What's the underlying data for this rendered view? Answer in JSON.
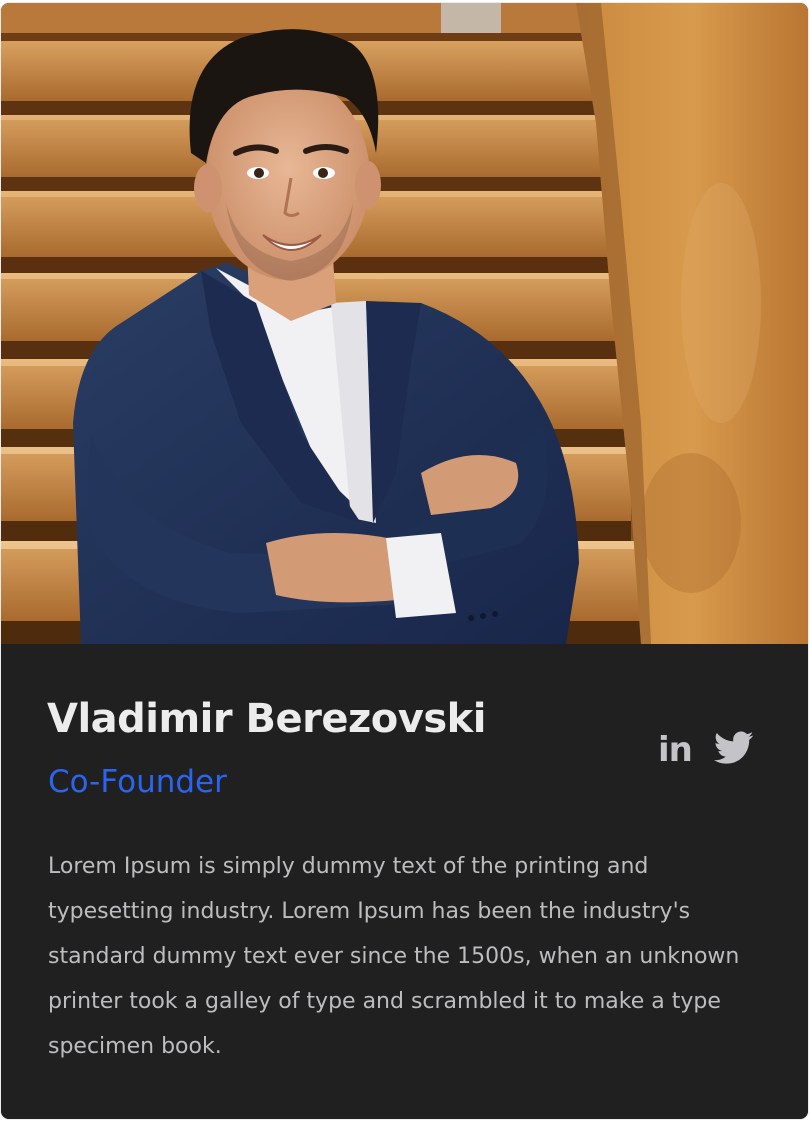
{
  "profile": {
    "name": "Vladimir Berezovski",
    "role": "Co-Founder",
    "bio": "Lorem Ipsum is simply dummy text of the printing and typesetting industry. Lorem Ipsum has been the industry's standard dummy text ever since the 1500s, when an unknown printer took a galley of type and scrambled it to make a type specimen book."
  },
  "social": {
    "linkedin_label": "in",
    "linkedin_icon": "linkedin-icon",
    "twitter_icon": "twitter-icon"
  },
  "colors": {
    "card_background": "#202020",
    "name_text": "#ececec",
    "role_accent": "#2b64ee",
    "bio_text": "#bdbdc0",
    "icon_color": "#c3c3c8"
  }
}
